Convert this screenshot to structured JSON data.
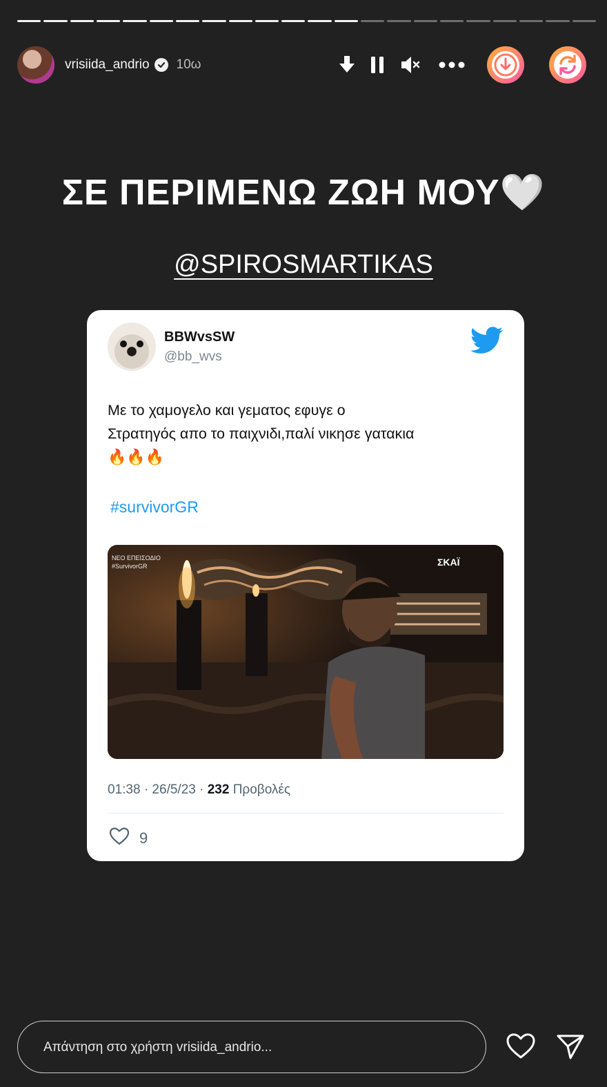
{
  "progress": {
    "total_segments": 22,
    "completed_segments": 13
  },
  "header": {
    "username": "vrisiida_andrio",
    "time_ago": "10ω"
  },
  "story": {
    "headline": "ΣΕ ΠΕΡΙΜΕΝΩ ΖΩΗ ΜΟΥ🤍",
    "mention": "@SPIROSMARTIKAS"
  },
  "tweet": {
    "display_name": "BBWvsSW",
    "handle": "@bb_wvs",
    "text_line1": "Με το χαμογελο  και γεματος εφυγε ο",
    "text_line2": "Στρατηγός απο το παιχνιδι,παλί νικησε γατακια",
    "flames": "🔥🔥🔥",
    "hashtag": "#survivorGR",
    "media_overlay_left_1": "ΝΕΟ ΕΠΕΙΣΟΔΙΟ",
    "media_overlay_left_2": "#SurvivorGR",
    "media_overlay_right": "ΣΚΑΪ",
    "timestamp": "01:38 · 26/5/23 · ",
    "views_count": "232",
    "views_label": " Προβολές",
    "like_count": "9"
  },
  "reply": {
    "placeholder": "Απάντηση στο χρήστη vrisiida_andrio..."
  },
  "colors": {
    "background": "#212121",
    "twitter_blue": "#1d9bf0",
    "action_gradient": [
      "#ffb03a",
      "#ff5aa0"
    ]
  },
  "icons": [
    "download-arrow-icon",
    "pause-icon",
    "mute-icon",
    "more-icon",
    "download-circle-icon",
    "repost-circle-icon",
    "verified-icon",
    "twitter-bird-icon",
    "heart-icon",
    "send-icon"
  ]
}
